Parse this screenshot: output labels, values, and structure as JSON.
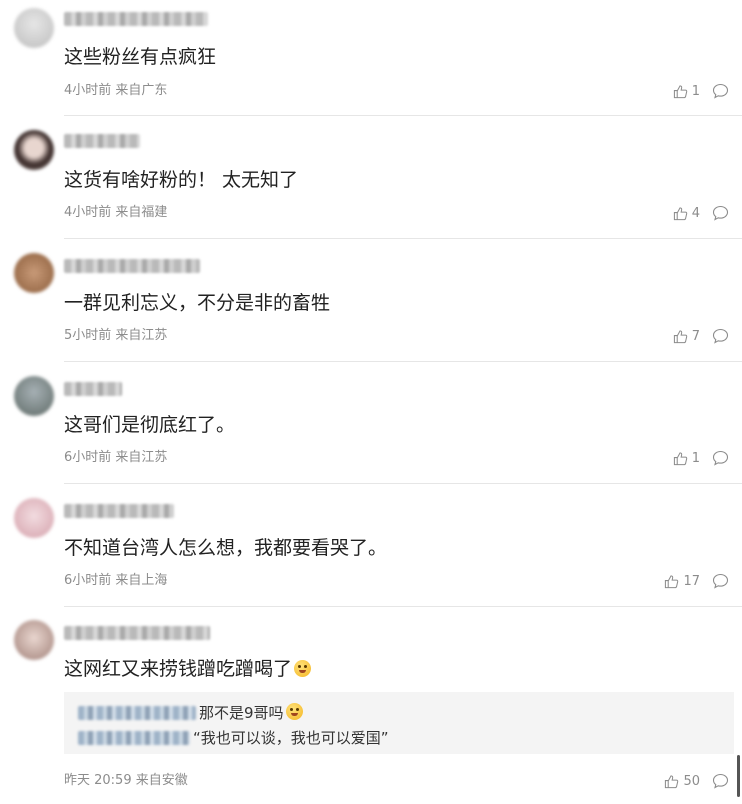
{
  "comments": [
    {
      "text": "这些粉丝有点疯狂",
      "meta": "4小时前 来自广东",
      "likes": "1",
      "avatar_color": "#c8c8c8"
    },
    {
      "text": "这货有啥好粉的！ 太无知了",
      "meta": "4小时前 来自福建",
      "likes": "4",
      "avatar_color": "#6b5a55"
    },
    {
      "text": "一群见利忘义，不分是非的畜牲",
      "meta": "5小时前 来自江苏",
      "likes": "7",
      "avatar_color": "#a07850"
    },
    {
      "text": "这哥们是彻底红了。",
      "meta": "6小时前 来自江苏",
      "likes": "1",
      "avatar_color": "#8a9290"
    },
    {
      "text": "不知道台湾人怎么想，我都要看哭了。",
      "meta": "6小时前 来自上海",
      "likes": "17",
      "avatar_color": "#e0b8c0"
    },
    {
      "text": "这网红又来捞钱蹭吃蹭喝了",
      "meta": "昨天 20:59 来自安徽",
      "likes": "50",
      "avatar_color": "#b89a90"
    }
  ],
  "replies": [
    {
      "text": "那不是9哥吗"
    },
    {
      "text": "“我也可以谈，我也可以爱国”"
    }
  ],
  "icons": {
    "like": "thumbs-up-icon",
    "reply": "comment-bubble-icon",
    "emoji": "smile-emoji-icon"
  }
}
